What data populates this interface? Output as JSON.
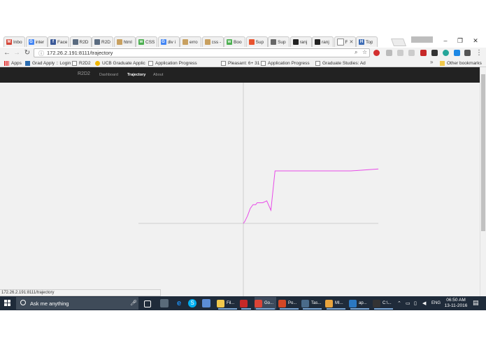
{
  "browser": {
    "tabs": [
      {
        "label": "Inbo",
        "icon": "gmail-icon",
        "color": "#d44638",
        "glyph": "M"
      },
      {
        "label": "inter",
        "icon": "google-icon",
        "color": "#4285f4",
        "glyph": "G"
      },
      {
        "label": "Face",
        "icon": "facebook-icon",
        "color": "#3b5998",
        "glyph": "f"
      },
      {
        "label": "R2D",
        "icon": "page-icon",
        "color": "#5a6b80",
        "glyph": ""
      },
      {
        "label": "R2D",
        "icon": "page-icon",
        "color": "#5a6b80",
        "glyph": ""
      },
      {
        "label": "html",
        "icon": "page-icon",
        "color": "#c8a060",
        "glyph": ""
      },
      {
        "label": "CSS",
        "icon": "w3schools-icon",
        "color": "#4caf50",
        "glyph": "w"
      },
      {
        "label": "div i",
        "icon": "google-icon",
        "color": "#4285f4",
        "glyph": "G"
      },
      {
        "label": "erro",
        "icon": "page-icon",
        "color": "#c8a060",
        "glyph": ""
      },
      {
        "label": "css -",
        "icon": "page-icon",
        "color": "#c8a060",
        "glyph": ""
      },
      {
        "label": "Boo",
        "icon": "w3schools-icon",
        "color": "#4caf50",
        "glyph": "w"
      },
      {
        "label": "Sup",
        "icon": "extension-icon",
        "color": "#e8542f",
        "glyph": ""
      },
      {
        "label": "Sup",
        "icon": "extension-icon",
        "color": "#666666",
        "glyph": ""
      },
      {
        "label": "ranj",
        "icon": "github-icon",
        "color": "#222222",
        "glyph": ""
      },
      {
        "label": "ranj",
        "icon": "github-icon",
        "color": "#222222",
        "glyph": ""
      },
      {
        "label": "F",
        "icon": "page-icon",
        "color": "#ffffff",
        "glyph": "",
        "active": true
      },
      {
        "label": "Top",
        "icon": "heroku-icon",
        "color": "#3e6db5",
        "glyph": "H"
      }
    ],
    "active_tab_close": "✕",
    "url": "172.26.2.191:8111/trajectory",
    "bookmarks": [
      {
        "label": "Apps"
      },
      {
        "label": "Grad Apply :: Login"
      },
      {
        "label": "R2D2"
      },
      {
        "label": "UCB Graduate Applic"
      },
      {
        "label": "Application Progress"
      },
      {
        "label": "Pleasant: 6+ 31"
      },
      {
        "label": "Application Progress"
      },
      {
        "label": "Graduate Studies: Ad"
      }
    ],
    "bookmarks_overflow": "»",
    "other_bookmarks": "Other bookmarks",
    "status_url": "172.26.2.191:8111/trajectory"
  },
  "site": {
    "brand": "R2D2",
    "nav": [
      {
        "label": "Dashboard",
        "active": false
      },
      {
        "label": "Trajectory",
        "active": true
      },
      {
        "label": "About",
        "active": false
      }
    ],
    "path_color": "#e84be8",
    "axis_color": "#cfcfcf"
  },
  "chart_data": {
    "type": "line",
    "title": "",
    "xlabel": "",
    "ylabel": "",
    "grid": false,
    "xlim": [
      -1,
      1
    ],
    "ylim": [
      -1,
      1
    ],
    "series": [
      {
        "x": [
          0,
          0.01,
          0.03,
          0.05,
          0.07,
          0.09,
          0.1,
          0.12,
          0.14,
          0.17,
          0.2,
          0.23,
          0.33,
          0.5,
          0.66,
          0.78,
          0.98
        ],
        "y": [
          0,
          0.01,
          0.04,
          0.08,
          0.1,
          0.1,
          0.11,
          0.11,
          0.11,
          0.12,
          0.07,
          0.28,
          0.28,
          0.28,
          0.28,
          0.28,
          0.29
        ]
      }
    ]
  },
  "taskbar": {
    "search_placeholder": "Ask me anything",
    "items": [
      {
        "label": "Fil...",
        "color": "#f2c94c"
      },
      {
        "label": "",
        "color": "#c62828"
      },
      {
        "label": "Go...",
        "color": "#db4437"
      },
      {
        "label": "Po...",
        "color": "#d24726"
      },
      {
        "label": "Tas...",
        "color": "#4a6b8a"
      },
      {
        "label": "MI...",
        "color": "#e8a33d"
      },
      {
        "label": "ap...",
        "color": "#2b78c2"
      },
      {
        "label": "C:\\...",
        "color": "#333333"
      }
    ],
    "language": "ENG",
    "time": "06:50 AM",
    "date": "13-11-2016"
  }
}
